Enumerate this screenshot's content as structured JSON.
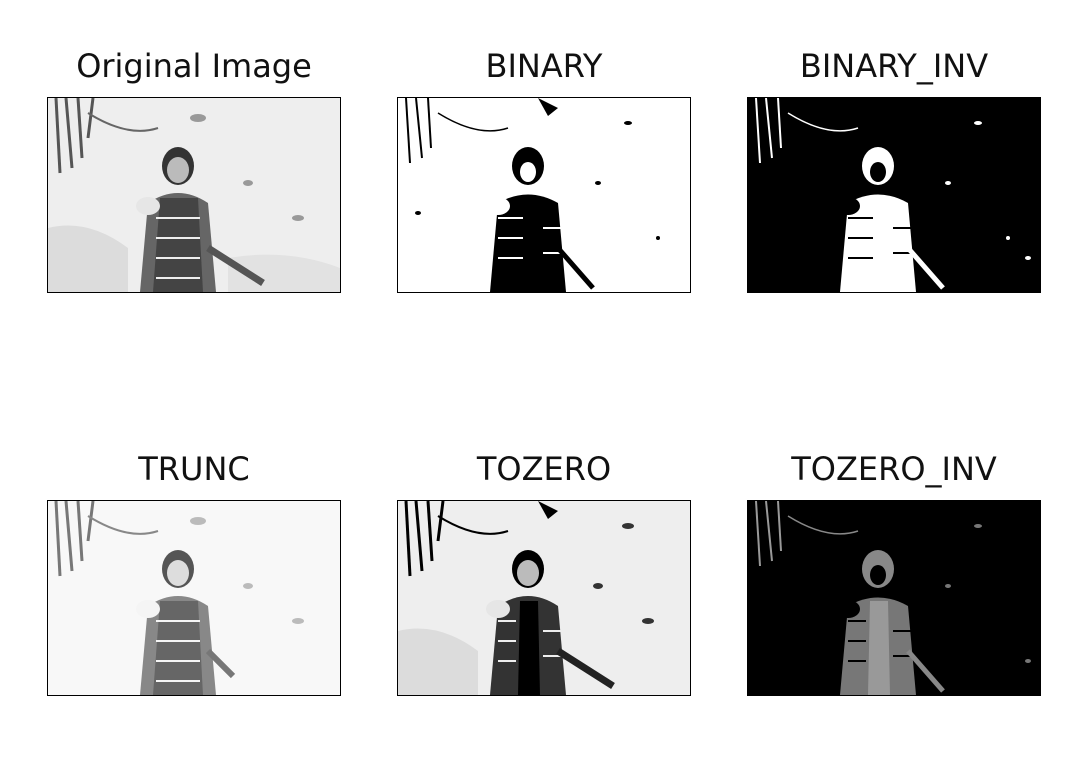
{
  "panels": [
    {
      "title": "Original Image"
    },
    {
      "title": "BINARY"
    },
    {
      "title": "BINARY_INV"
    },
    {
      "title": "TRUNC"
    },
    {
      "title": "TOZERO"
    },
    {
      "title": "TOZERO_INV"
    }
  ]
}
